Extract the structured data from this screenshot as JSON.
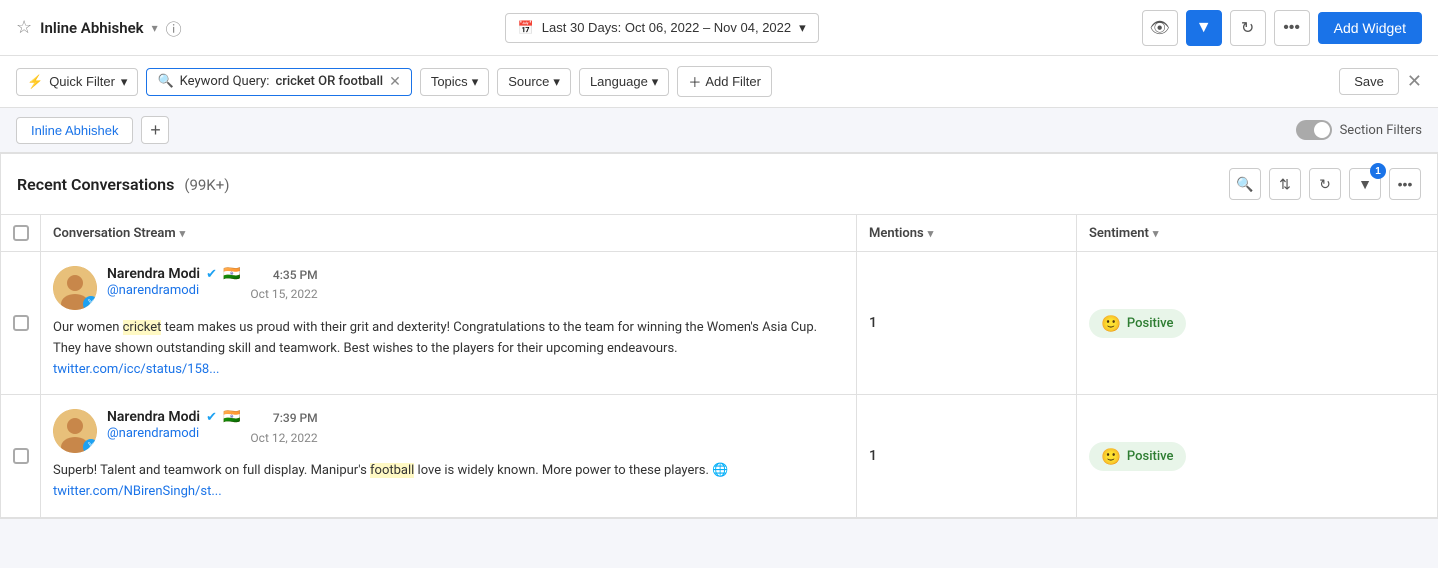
{
  "header": {
    "star_icon": "☆",
    "workspace_name": "Inline Abhishek",
    "chevron": "▾",
    "info": "ⓘ",
    "date_range_label": "Last 30 Days: Oct 06, 2022 – Nov 04, 2022",
    "add_widget_label": "Add Widget"
  },
  "filter_bar": {
    "quick_filter_label": "Quick Filter",
    "keyword_label": "Keyword Query:",
    "keyword_value": "cricket OR football",
    "topics_label": "Topics",
    "source_label": "Source",
    "language_label": "Language",
    "add_filter_label": "Add Filter",
    "save_label": "Save"
  },
  "tab_bar": {
    "tab_label": "Inline Abhishek",
    "section_filters_label": "Section Filters"
  },
  "widget": {
    "title": "Recent Conversations",
    "count": "(99K+)"
  },
  "table": {
    "columns": [
      {
        "label": "Conversation Stream"
      },
      {
        "label": "Mentions"
      },
      {
        "label": "Sentiment"
      }
    ],
    "rows": [
      {
        "author_name": "Narendra Modi",
        "handle": "@narendramodi",
        "time": "4:35 PM",
        "date": "Oct 15, 2022",
        "text_before": "Our women ",
        "text_highlight": "cricket",
        "text_after": " team makes us proud with their grit and dexterity! Congratulations to the team for winning the Women's Asia Cup. They have shown outstanding skill and teamwork. Best wishes to the players for their upcoming endeavours.",
        "link": " twitter.com/icc/status/158...",
        "mentions": "1",
        "sentiment": "Positive"
      },
      {
        "author_name": "Narendra Modi",
        "handle": "@narendramodi",
        "time": "7:39 PM",
        "date": "Oct 12, 2022",
        "text_before": "Superb! Talent and teamwork on full display. Manipur's ",
        "text_highlight": "football",
        "text_after": " love is widely known.  More power to these players. 🌐",
        "link": " twitter.com/NBirenSingh/st...",
        "mentions": "1",
        "sentiment": "Positive"
      }
    ]
  }
}
